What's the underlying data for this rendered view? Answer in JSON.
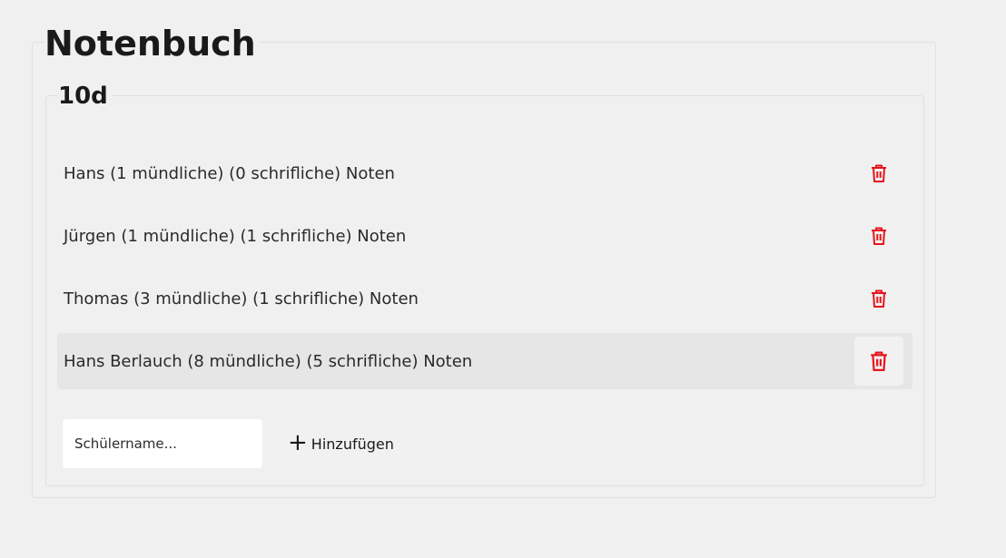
{
  "app": {
    "title": "Notenbuch"
  },
  "class_group": {
    "title": "10d",
    "students": [
      {
        "label": "Hans (1 mündliche) (0 schrifliche) Noten",
        "hovered": false
      },
      {
        "label": "Jürgen (1 mündliche) (1 schrifliche) Noten",
        "hovered": false
      },
      {
        "label": "Thomas (3 mündliche) (1 schrifliche) Noten",
        "hovered": false
      },
      {
        "label": "Hans Berlauch (8 mündliche) (5 schrifliche) Noten",
        "hovered": true
      }
    ]
  },
  "add_form": {
    "input_placeholder": "Schülername...",
    "input_value": "",
    "add_button_label": "Hinzufügen",
    "add_icon": "plus-icon"
  },
  "icons": {
    "delete": "trash-icon"
  },
  "colors": {
    "delete_icon": "#e8141c",
    "background": "#f0f0f0",
    "hover_row": "#e6e6e6"
  }
}
